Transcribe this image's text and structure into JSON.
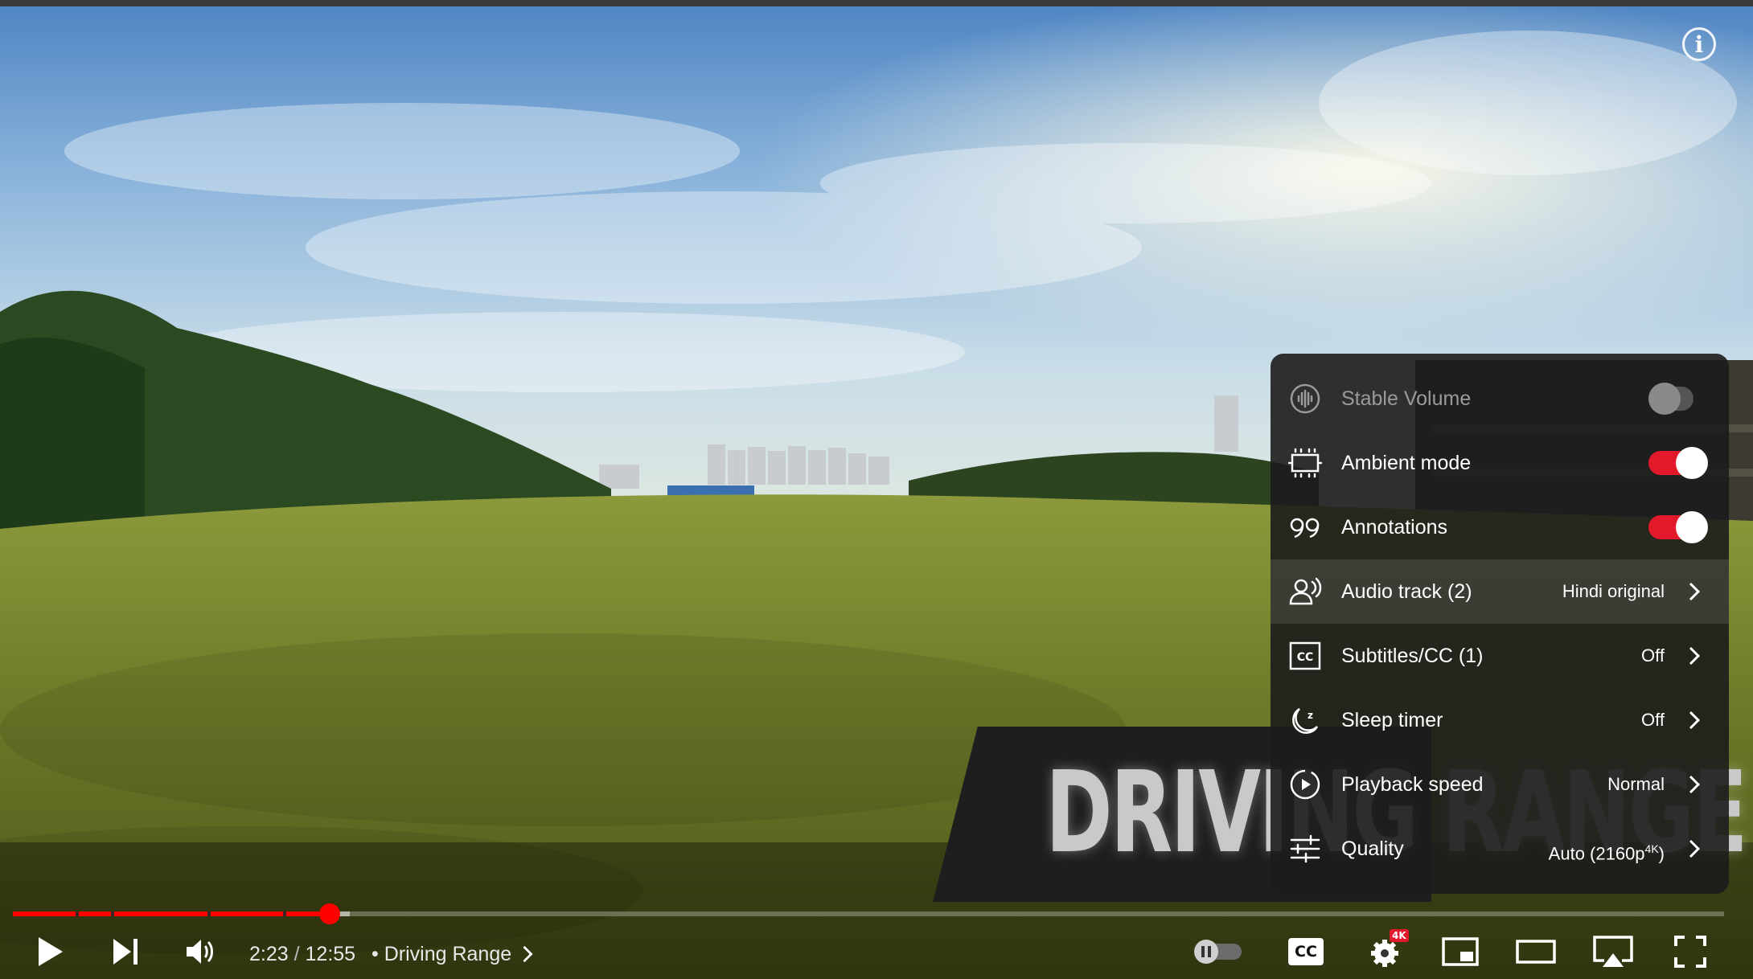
{
  "video": {
    "title_overlay": "DRIVING RANGE",
    "current_time": "2:23",
    "duration": "12:55",
    "time_separator": " / ",
    "chapter_bullet": "•",
    "chapter_title": "Driving Range",
    "played_fraction": 0.185,
    "buffered_fraction": 0.197
  },
  "settings_menu": {
    "items": [
      {
        "label": "Stable Volume",
        "toggle": false,
        "icon": "stable-volume-icon",
        "disabled": true
      },
      {
        "label": "Ambient mode",
        "toggle": true,
        "icon": "ambient-mode-icon"
      },
      {
        "label": "Annotations",
        "toggle": true,
        "icon": "annotations-icon"
      },
      {
        "label": "Audio track (2)",
        "value": "Hindi original",
        "icon": "audio-track-icon"
      },
      {
        "label": "Subtitles/CC (1)",
        "value": "Off",
        "icon": "subtitles-icon"
      },
      {
        "label": "Sleep timer",
        "value": "Off",
        "icon": "sleep-timer-icon"
      },
      {
        "label": "Playback speed",
        "value": "Normal",
        "icon": "playback-speed-icon"
      },
      {
        "label": "Quality",
        "value": "Auto (2160p",
        "value_sup": "4K",
        "value_suffix": ")",
        "icon": "quality-icon"
      }
    ]
  },
  "controls": {
    "settings_badge": "4K",
    "cc_label": "CC"
  },
  "colors": {
    "accent": "#ff0000",
    "toggle_on": "#e2182b"
  }
}
